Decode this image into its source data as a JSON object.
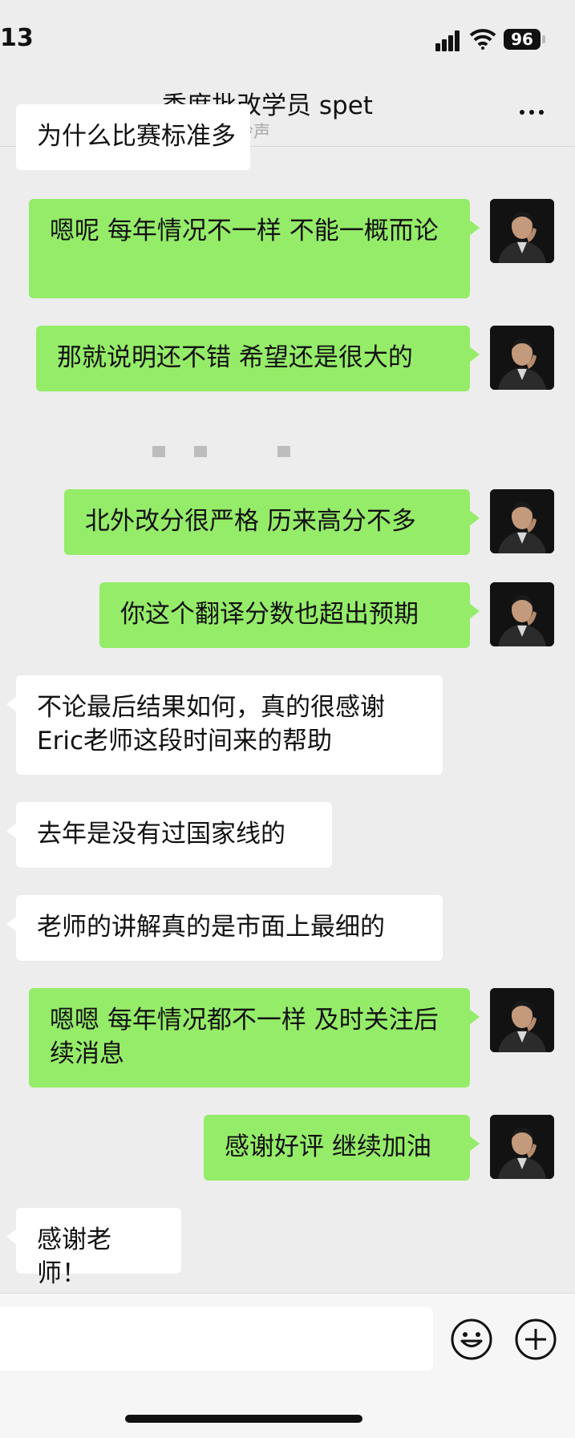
{
  "status_bar": {
    "time": "13",
    "battery": "96"
  },
  "nav": {
    "title": "季度批改学员 spet",
    "subtitle": "换铃声"
  },
  "messages": [
    {
      "side": "them",
      "text": "为什么比赛标准多"
    },
    {
      "side": "me",
      "text": "嗯呢 每年情况不一样 不能一概而论"
    },
    {
      "side": "me",
      "text": "那就说明还不错 希望还是很大的"
    },
    {
      "side": "me",
      "text": "北外改分很严格 历来高分不多"
    },
    {
      "side": "me",
      "text": "你这个翻译分数也超出预期"
    },
    {
      "side": "them",
      "text": "不论最后结果如何，真的很感谢Eric老师这段时间来的帮助"
    },
    {
      "side": "them",
      "text": "去年是没有过国家线的"
    },
    {
      "side": "them",
      "text": "老师的讲解真的是市面上最细的"
    },
    {
      "side": "me",
      "text": "嗯嗯 每年情况都不一样 及时关注后续消息"
    },
    {
      "side": "me",
      "text": "感谢好评 继续加油"
    },
    {
      "side": "them",
      "text": "感谢老师！"
    }
  ],
  "icons": {
    "signal": "signal-icon",
    "wifi": "wifi-icon",
    "bell": "bell-icon",
    "more": "more-icon",
    "avatar": "avatar",
    "emoji": "emoji-icon",
    "add": "add-icon"
  },
  "colors": {
    "background": "#ededed",
    "bubble_me": "#95ec69",
    "bubble_them": "#ffffff"
  }
}
